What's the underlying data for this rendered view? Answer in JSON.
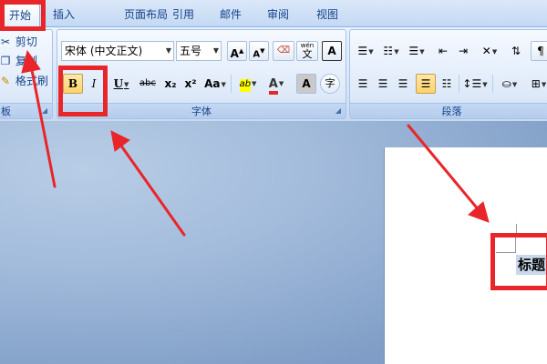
{
  "tabs": [
    {
      "label": "开始",
      "active": true
    },
    {
      "label": "插入"
    },
    {
      "label": "页面布局"
    },
    {
      "label": "引用"
    },
    {
      "label": "邮件"
    },
    {
      "label": "审阅"
    },
    {
      "label": "视图"
    }
  ],
  "clipboard": {
    "cut_label": "剪切",
    "copy_label": "复制",
    "format_painter_label": "格式刷",
    "group_label": "板"
  },
  "font": {
    "font_name": "宋体 (中文正文)",
    "font_size": "五号",
    "grow_label": "A",
    "shrink_label": "A",
    "pinyin_glyph": "wén",
    "pinyin_char": "文",
    "border_char": "A",
    "bold_label": "B",
    "italic_label": "I",
    "underline_label": "U",
    "strike_label": "abc",
    "sub_label": "x₂",
    "sup_label": "x²",
    "case_label": "Aa",
    "highlight_label": "ab",
    "color_label": "A",
    "shade_label": "A",
    "enclose_label": "字",
    "group_label": "字体"
  },
  "paragraph": {
    "group_label": "段落"
  },
  "document": {
    "heading_text": "标题"
  },
  "colors": {
    "accent_red": "#e8262a",
    "ribbon_blue": "#15428b"
  }
}
